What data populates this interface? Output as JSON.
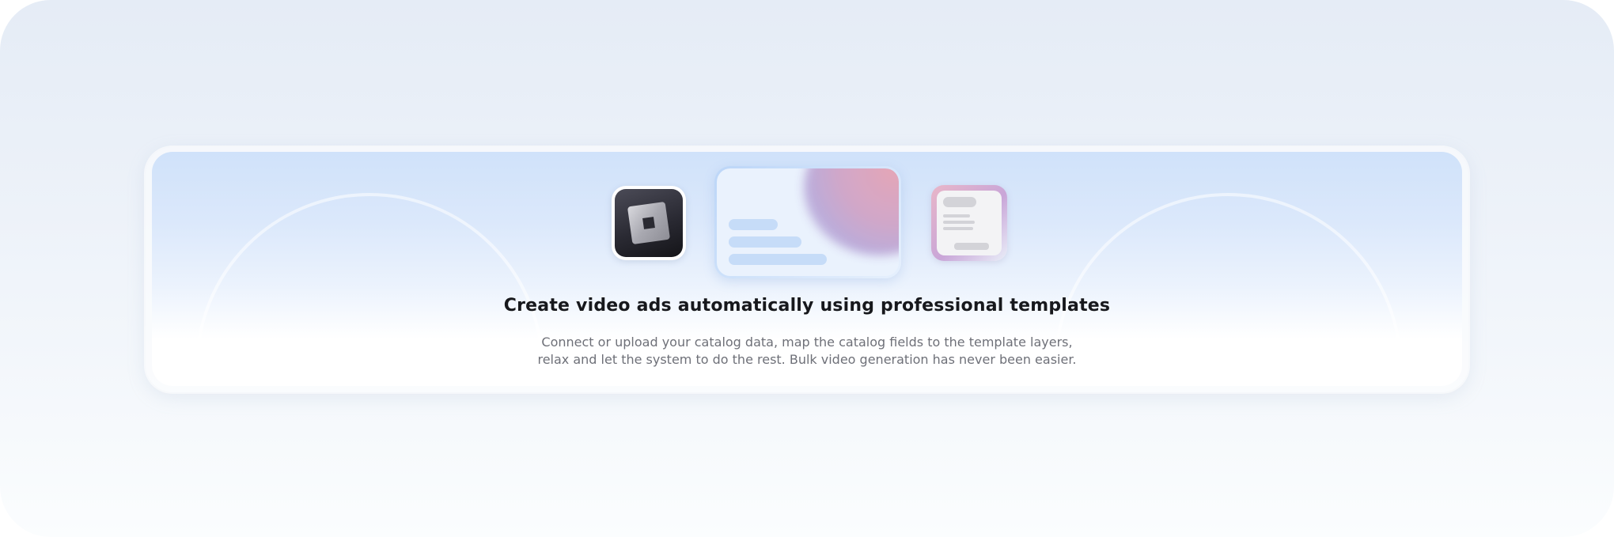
{
  "empty_state": {
    "title": "Create video ads automatically using professional templates",
    "description_line1": "Connect or upload your catalog data, map the catalog fields to the template layers,",
    "description_line2": "relax and let the system to do the rest. Bulk video generation has never been easier."
  },
  "illustration": {
    "icons": [
      "app-logo-icon",
      "video-template-preview-icon",
      "catalog-document-icon"
    ]
  },
  "colors": {
    "title": "#17181c",
    "description": "#6e7078",
    "card_top": "#d0e2fa",
    "accent_pink": "#e5a2b3",
    "accent_purple": "#b8a8d8"
  }
}
